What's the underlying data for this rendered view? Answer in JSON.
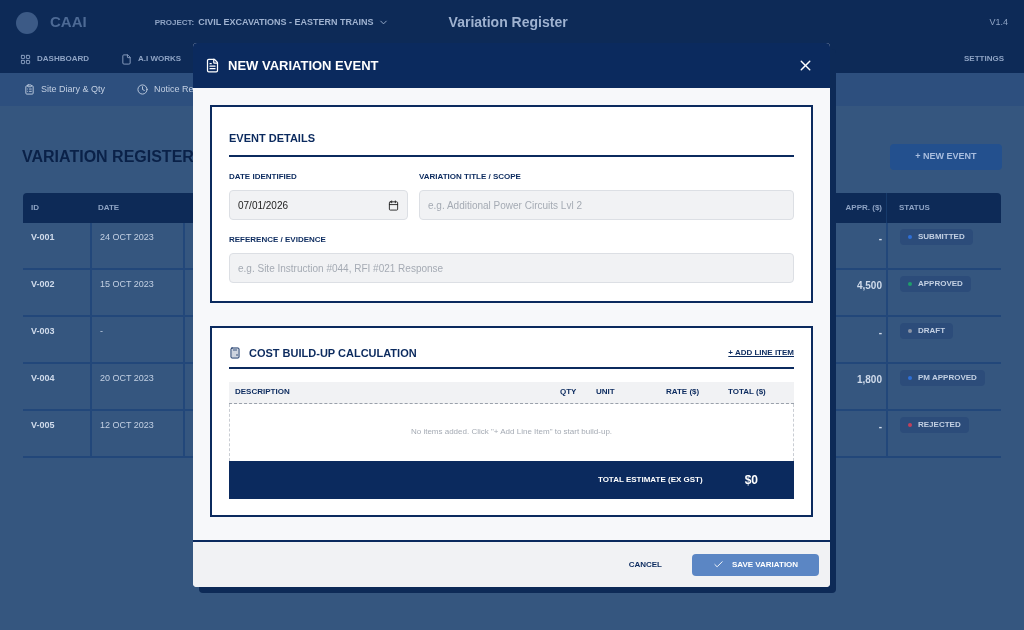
{
  "app": {
    "logo": "CAAI",
    "project_label": "PROJECT:",
    "project": "CIVIL EXCAVATIONS - EASTERN TRAINS",
    "page_title": "Variation Register",
    "version": "V1.4",
    "nav": [
      {
        "label": "DASHBOARD"
      },
      {
        "label": "A.I WORKS"
      }
    ],
    "settings": "SETTINGS",
    "subnav": [
      {
        "label": "Site Diary & Qty"
      },
      {
        "label": "Notice Re"
      }
    ],
    "heading": "VARIATION REGISTER",
    "new_button": "+ NEW EVENT",
    "table": {
      "columns": [
        "ID",
        "DATE",
        "APPR. ($)",
        "STATUS"
      ],
      "rows": [
        {
          "id": "V-001",
          "date": "24 OCT 2023",
          "appr": "-",
          "status": "SUBMITTED",
          "color": "#2f6fd6"
        },
        {
          "id": "V-002",
          "date": "15 OCT 2023",
          "appr": "4,500",
          "status": "APPROVED",
          "color": "#1f9d6b"
        },
        {
          "id": "V-003",
          "date": "-",
          "appr": "-",
          "status": "DRAFT",
          "color": "#8a94a6"
        },
        {
          "id": "V-004",
          "date": "20 OCT 2023",
          "appr": "1,800",
          "status": "PM APPROVED",
          "color": "#2f6fd6"
        },
        {
          "id": "V-005",
          "date": "12 OCT 2023",
          "appr": "-",
          "status": "REJECTED",
          "color": "#c2405a"
        }
      ]
    }
  },
  "modal": {
    "title": "NEW VARIATION EVENT",
    "event_details": {
      "title": "EVENT DETAILS",
      "date_label": "DATE IDENTIFIED",
      "date_value": "07/01/2026",
      "title_label": "VARIATION TITLE / SCOPE",
      "title_placeholder": "e.g. Additional Power Circuits Lvl 2",
      "ref_label": "REFERENCE / EVIDENCE",
      "ref_placeholder": "e.g. Site Instruction #044, RFI #021 Response"
    },
    "cost": {
      "title": "COST BUILD-UP CALCULATION",
      "add_link": "+ ADD LINE ITEM",
      "columns": [
        "DESCRIPTION",
        "QTY",
        "UNIT",
        "RATE ($)",
        "TOTAL ($)"
      ],
      "empty": "No items added. Click \"+ Add Line Item\" to start build-up.",
      "total_label": "TOTAL ESTIMATE (EX GST)",
      "total": "$0"
    },
    "cancel": "CANCEL",
    "save": "SAVE VARIATION"
  }
}
